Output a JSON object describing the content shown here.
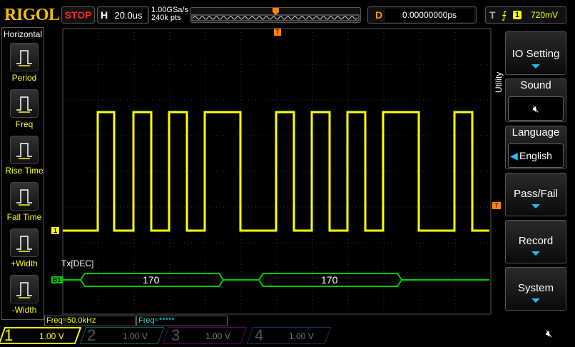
{
  "header": {
    "logo": "RIGOL",
    "run_state": "STOP",
    "h_label": "H",
    "timebase": "20.0us",
    "sample_rate": "1.00GSa/s",
    "memory_depth": "240k pts",
    "trigger_pos_marker": "T",
    "d_label": "D",
    "delay": "0.00000000ps",
    "t_label": "T",
    "trigger_source": "1",
    "trigger_level": "720mV"
  },
  "left_menu": {
    "title": "Horizontal",
    "items": [
      {
        "label": "Period",
        "icon": "period-icon"
      },
      {
        "label": "Freq",
        "icon": "freq-icon"
      },
      {
        "label": "Rise Time",
        "icon": "rise-time-icon"
      },
      {
        "label": "Fall Time",
        "icon": "fall-time-icon"
      },
      {
        "label": "+Width",
        "icon": "positive-width-icon"
      },
      {
        "label": "-Width",
        "icon": "negative-width-icon"
      }
    ]
  },
  "right_menu": {
    "title": "Utility",
    "io_setting": "IO Setting",
    "sound": "Sound",
    "sound_icon": "speaker-muted-icon",
    "language": "Language",
    "language_value": "English",
    "pass_fail": "Pass/Fail",
    "record": "Record",
    "system": "System"
  },
  "waveform": {
    "ch1_marker": "1",
    "bus_marker": "B1",
    "bus_label": "Tx[DEC]",
    "bus_values": [
      "170",
      "170"
    ],
    "trigger_marker": "T",
    "ch1_color": "#ffff00",
    "bus_color": "#00cc00"
  },
  "measurements": {
    "m1": "Freq=50.0kHz",
    "m2": "Freq=*****"
  },
  "channels": [
    {
      "num": "1",
      "scale": "1.00 V",
      "color": "#ffff00"
    },
    {
      "num": "2",
      "scale": "1.00 V",
      "color": "#00a0a0"
    },
    {
      "num": "3",
      "scale": "1.00 V",
      "color": "#c000c0"
    },
    {
      "num": "4",
      "scale": "1.00 V",
      "color": "#2060c0"
    }
  ],
  "status": {
    "sound_icon": "speaker-muted-icon"
  }
}
